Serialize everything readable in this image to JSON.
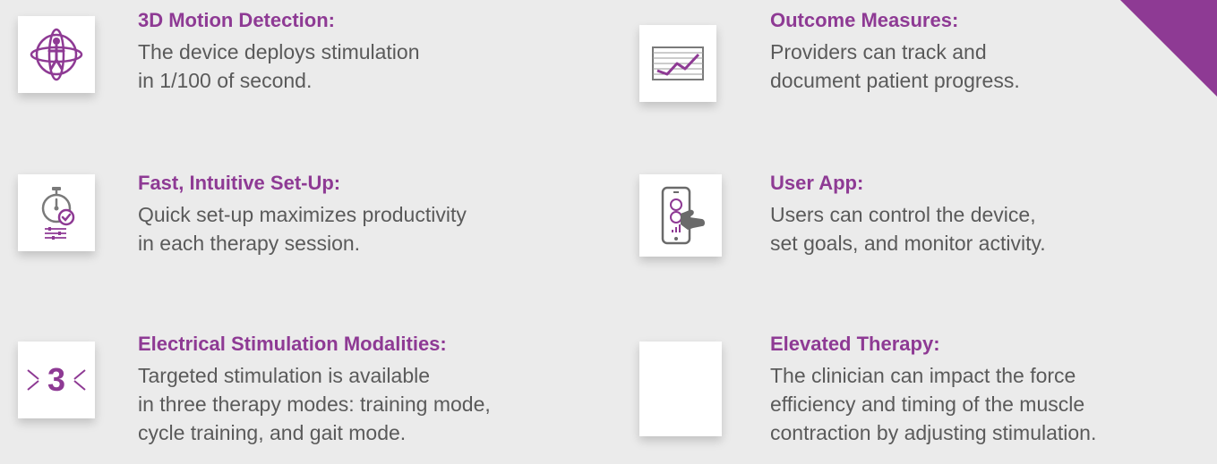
{
  "accent_color": "#8e3a94",
  "features": [
    {
      "icon": "motion-detection-icon",
      "title": "3D Motion Detection:",
      "lines": [
        "The device deploys stimulation",
        "in 1/100 of second."
      ]
    },
    {
      "icon": "stopwatch-settings-icon",
      "title": "Fast, Intuitive Set-Up:",
      "lines": [
        "Quick set-up maximizes productivity",
        "in each therapy session."
      ]
    },
    {
      "icon": "three-modes-icon",
      "icon_text": "3",
      "title": "Electrical Stimulation Modalities:",
      "lines": [
        "Targeted stimulation is available",
        "in three therapy modes: training mode,",
        "cycle training, and gait mode."
      ]
    },
    {
      "icon": "line-chart-icon",
      "title": "Outcome Measures:",
      "lines": [
        "Providers can track and",
        "document patient progress."
      ]
    },
    {
      "icon": "phone-app-icon",
      "title": "User App:",
      "lines": [
        "Users can control the device,",
        "set goals, and monitor activity."
      ]
    },
    {
      "icon": "blank-icon",
      "title": "Elevated Therapy:",
      "lines": [
        "The clinician can impact the force",
        "efficiency and timing of the muscle",
        "contraction by adjusting stimulation."
      ]
    }
  ]
}
